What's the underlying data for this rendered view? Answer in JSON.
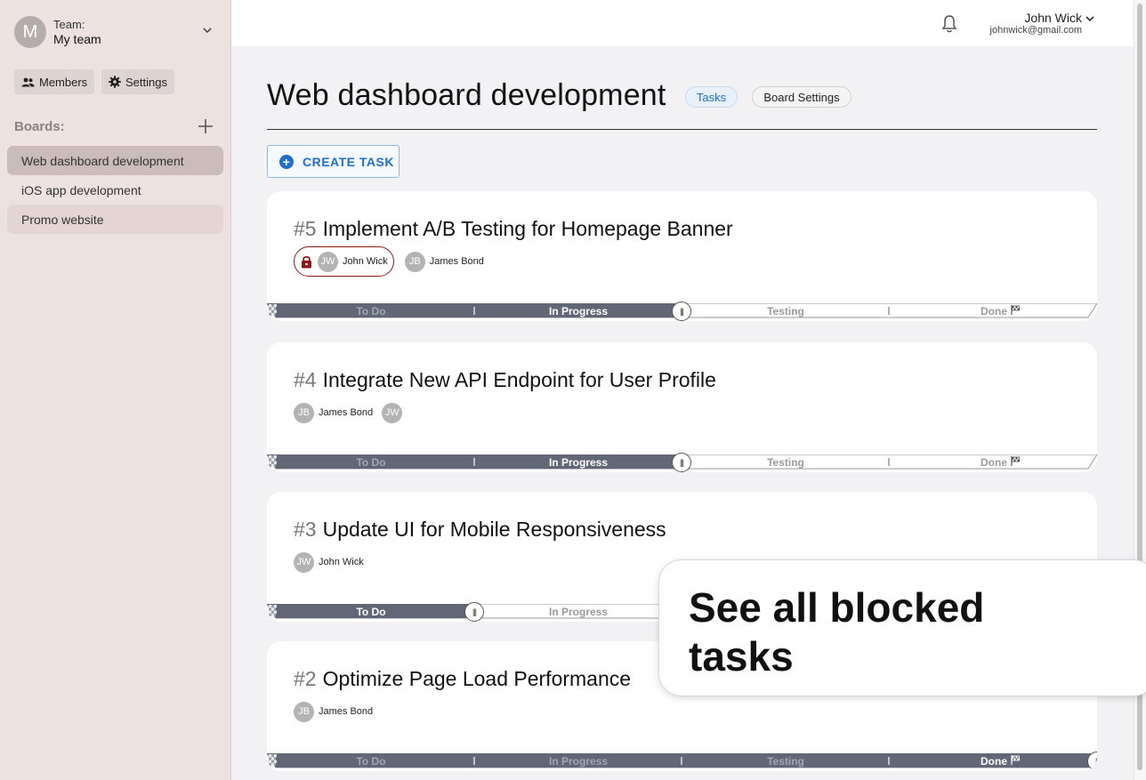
{
  "team": {
    "avatar_letter": "M",
    "label": "Team:",
    "name": "My team"
  },
  "sidebar": {
    "members_label": "Members",
    "settings_label": "Settings",
    "boards_label": "Boards:",
    "boards": [
      {
        "label": "Web dashboard development"
      },
      {
        "label": "iOS app development"
      },
      {
        "label": "Promo website"
      }
    ]
  },
  "user": {
    "name": "John Wick",
    "email": "johnwick@gmail.com"
  },
  "page": {
    "title": "Web dashboard development",
    "tabs": [
      {
        "label": "Tasks"
      },
      {
        "label": "Board Settings"
      }
    ],
    "create_task_label": "CREATE TASK"
  },
  "stages": [
    "To Do",
    "In Progress",
    "Testing",
    "Done"
  ],
  "tasks": [
    {
      "number": "#5",
      "title": "Implement A/B Testing for Homepage Banner",
      "blocked": true,
      "assignees": [
        {
          "initials": "JW",
          "name": "John Wick"
        },
        {
          "initials": "JB",
          "name": "James Bond"
        }
      ],
      "current_stage": "In Progress"
    },
    {
      "number": "#4",
      "title": "Integrate New API Endpoint for User Profile",
      "blocked": false,
      "assignees": [
        {
          "initials": "JB",
          "name": "James Bond"
        },
        {
          "initials": "JW",
          "name": ""
        }
      ],
      "current_stage": "In Progress"
    },
    {
      "number": "#3",
      "title": "Update UI for Mobile Responsiveness",
      "blocked": false,
      "assignees": [
        {
          "initials": "JW",
          "name": "John Wick"
        }
      ],
      "current_stage": "To Do"
    },
    {
      "number": "#2",
      "title": "Optimize Page Load Performance",
      "blocked": false,
      "assignees": [
        {
          "initials": "JB",
          "name": "James Bond"
        }
      ],
      "current_stage": "Done"
    }
  ],
  "tooltip": {
    "text": "See all blocked tasks"
  },
  "colors": {
    "progress_fill": "#626778",
    "accent": "#1f6fc8",
    "blocked": "#8b1a1a"
  }
}
